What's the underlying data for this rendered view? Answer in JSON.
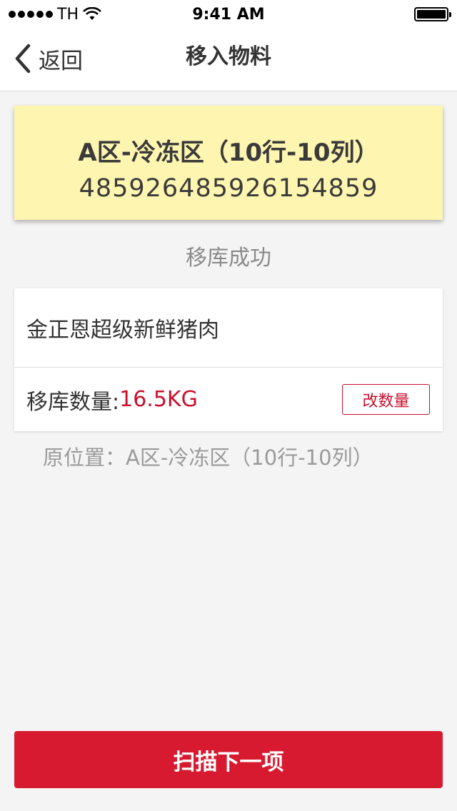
{
  "status_bar": {
    "carrier": "TH",
    "time": "9:41 AM",
    "battery_level": 1.0
  },
  "nav": {
    "back_label": "返回",
    "title": "移入物料"
  },
  "location_card": {
    "name": "A区-冷冻区（10行-10列）",
    "code": "485926485926154859",
    "background_color": "#fdf5b0"
  },
  "status_message": "移库成功",
  "product": {
    "name": "金正恩超级新鲜猪肉",
    "quantity_label": "移库数量:",
    "quantity_value": "16.5KG",
    "change_button": "改数量"
  },
  "original_location": "原位置：A区-冷冻区（10行-10列）",
  "scan_next_button": "扫描下一项",
  "colors": {
    "accent": "#d71a30",
    "quantity_text": "#c8102e"
  }
}
